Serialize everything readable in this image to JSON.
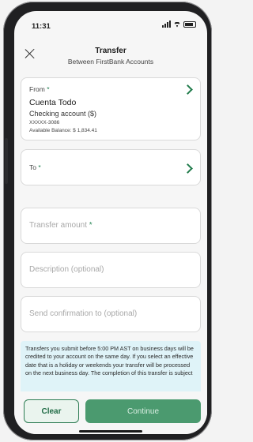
{
  "status_bar": {
    "time": "11:31"
  },
  "header": {
    "title": "Transfer",
    "subtitle": "Between FirstBank Accounts",
    "close_icon": "close-icon"
  },
  "from_account": {
    "label": "From",
    "required_mark": "*",
    "name": "Cuenta Todo",
    "type": "Checking account ($)",
    "number": "XXXXX-3086",
    "available_balance": "Available Balance: $ 1,834.41"
  },
  "to_account": {
    "label": "To",
    "required_mark": "*"
  },
  "fields": {
    "amount": {
      "placeholder": "Transfer amount",
      "required_mark": "*"
    },
    "description": {
      "placeholder": "Description (optional)"
    },
    "confirmation": {
      "placeholder": "Send confirmation to (optional)"
    }
  },
  "notice": {
    "text": "Transfers you submit before 5:00 PM AST on business days will be credited to your account on the same day. If you select an effective date that is a holiday or weekends your transfer will be processed on the next business day. The completion of this transfer is subject"
  },
  "actions": {
    "clear": "Clear",
    "continue": "Continue"
  },
  "colors": {
    "accent": "#1f7a4a",
    "continue_bg": "#4b9a6f",
    "notice_bg": "#dff3f8"
  }
}
